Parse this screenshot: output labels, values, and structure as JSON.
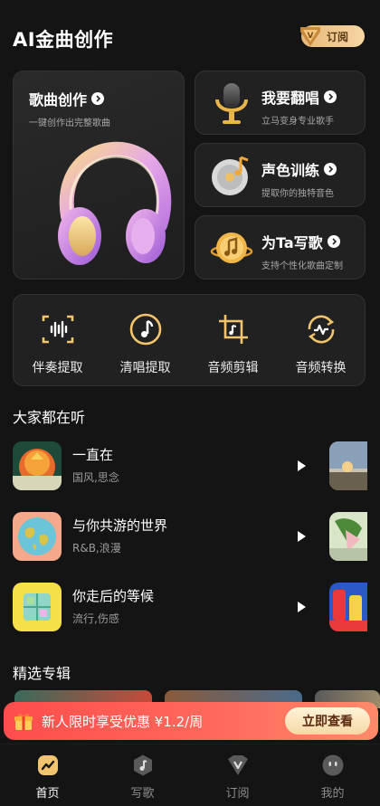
{
  "header": {
    "title": "AI金曲创作",
    "subscribe_label": "订阅"
  },
  "feature_cards": {
    "main": {
      "title": "歌曲创作",
      "subtitle": "一键创作出完整歌曲"
    },
    "cover": {
      "title": "我要翻唱",
      "subtitle": "立马变身专业歌手"
    },
    "voice": {
      "title": "声色训练",
      "subtitle": "提取你的独特音色"
    },
    "custom": {
      "title": "为Ta写歌",
      "subtitle": "支持个性化歌曲定制"
    }
  },
  "tools": [
    {
      "label": "伴奏提取",
      "icon": "waveform-icon"
    },
    {
      "label": "清唱提取",
      "icon": "music-note-icon"
    },
    {
      "label": "音频剪辑",
      "icon": "crop-icon"
    },
    {
      "label": "音频转换",
      "icon": "convert-icon"
    }
  ],
  "listening": {
    "title": "大家都在听",
    "songs": [
      {
        "name": "一直在",
        "tags": "国风,思念"
      },
      {
        "name": "与你共游的世界",
        "tags": "R&B,浪漫"
      },
      {
        "name": "你走后的等候",
        "tags": "流行,伤感"
      }
    ]
  },
  "albums": {
    "title": "精选专辑"
  },
  "promo": {
    "text": "新人限时享受优惠 ¥1.2/周",
    "button": "立即查看"
  },
  "tabbar": [
    {
      "label": "首页",
      "icon": "home-icon",
      "active": true
    },
    {
      "label": "写歌",
      "icon": "write-song-icon",
      "active": false
    },
    {
      "label": "订阅",
      "icon": "subscribe-icon",
      "active": false
    },
    {
      "label": "我的",
      "icon": "profile-icon",
      "active": false
    }
  ],
  "colors": {
    "background": "#141414",
    "card": "#212121",
    "accent_gold": "#f2c46d",
    "promo_red": "#ff4d4d"
  }
}
